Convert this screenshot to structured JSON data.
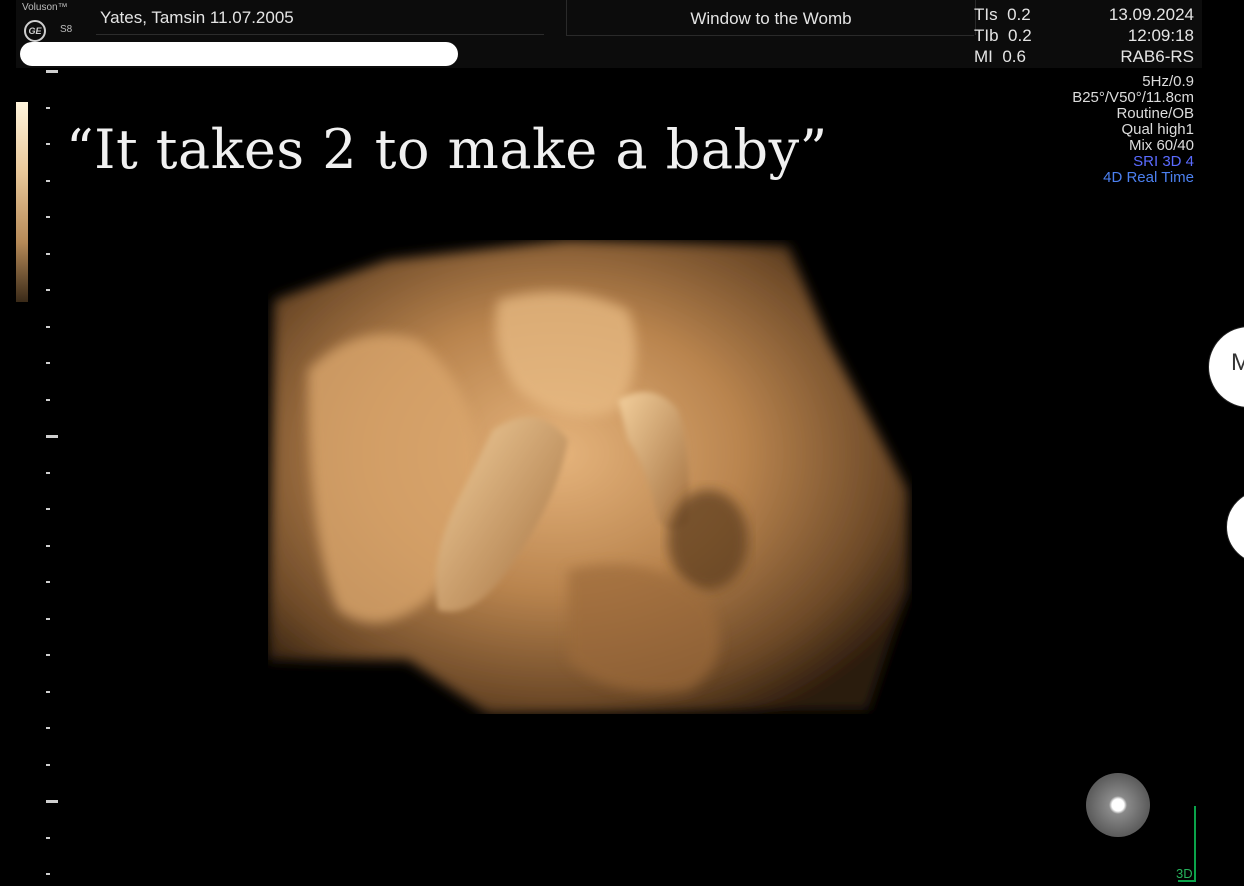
{
  "header": {
    "brand": "Voluson™",
    "logo_text": "GE",
    "model": "S8",
    "patient": "Yates, Tamsin  11.07.2005",
    "center_title": "Window to the Womb",
    "params": [
      {
        "label": "TIs",
        "value": "0.2"
      },
      {
        "label": "TIb",
        "value": "0.2"
      },
      {
        "label": "MI",
        "value": "0.6"
      }
    ],
    "date": "13.09.2024",
    "time": "12:09:18",
    "probe": "RAB6-RS"
  },
  "settings": {
    "frame_rate": "5Hz/0.9",
    "volume": "B25°/V50°/11.8cm",
    "preset": "Routine/OB",
    "quality": "Qual high1",
    "mix": "Mix 60/40",
    "sri": "SRI 3D 4",
    "mode": "4D Real Time"
  },
  "overlay": {
    "quote": "“It takes 2 to make a baby”"
  },
  "footer": {
    "mode_label": "3D"
  },
  "side_buttons": {
    "m_label": "M"
  },
  "colors": {
    "background": "#000000",
    "header_bg": "#0c0c0c",
    "scan_tone": "#c8955c",
    "sri_blue": "#5a6bff",
    "mode_blue": "#4c80f0",
    "indicator_green": "#0aa34a"
  },
  "icons": [
    "ge-logo-icon",
    "orientation-ball-icon"
  ]
}
